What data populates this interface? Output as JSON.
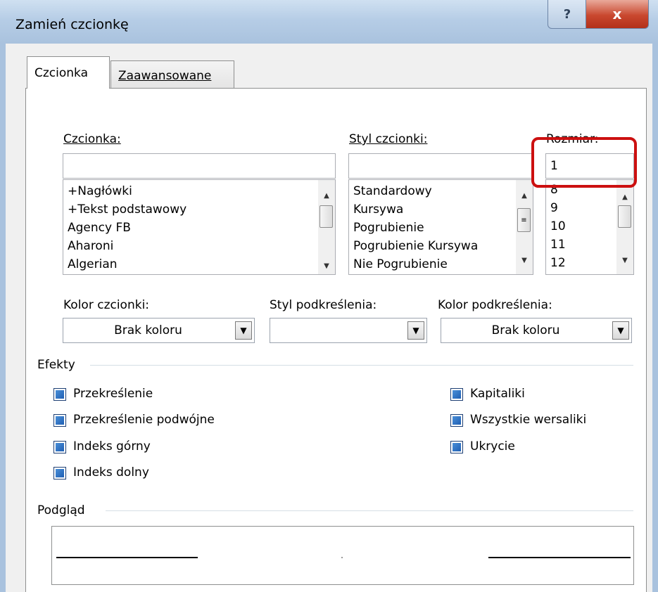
{
  "window": {
    "title": "Zamień czcionkę",
    "help_label": "?",
    "close_label": "x"
  },
  "tabs": [
    {
      "label": "Czcionka",
      "active": true
    },
    {
      "label": "Zaawansowane",
      "active": false
    }
  ],
  "font": {
    "label": "Czcionka:",
    "value": "",
    "items": [
      "+Nagłówki",
      "+Tekst podstawowy",
      "Agency FB",
      "Aharoni",
      "Algerian"
    ]
  },
  "style": {
    "label": "Styl czcionki:",
    "value": "",
    "items": [
      "Standardowy",
      "Kursywa",
      "Pogrubienie",
      "Pogrubienie Kursywa",
      "Nie Pogrubienie"
    ]
  },
  "size": {
    "label": "Rozmiar:",
    "value": "1",
    "items": [
      "8",
      "9",
      "10",
      "11",
      "12"
    ]
  },
  "font_color": {
    "label": "Kolor czcionki:",
    "value": "Brak koloru"
  },
  "underline_style": {
    "label": "Styl podkreślenia:",
    "value": ""
  },
  "underline_color": {
    "label": "Kolor podkreślenia:",
    "value": "Brak koloru"
  },
  "effects": {
    "label": "Efekty",
    "left": [
      "Przekreślenie",
      "Przekreślenie podwójne",
      "Indeks górny",
      "Indeks dolny"
    ],
    "right": [
      "Kapitaliki",
      "Wszystkie wersaliki",
      "Ukrycie"
    ]
  },
  "preview": {
    "label": "Podgląd"
  },
  "colors": {
    "highlight": "#cc1010",
    "checkbox": "#1f5fb3",
    "title_bar": "#b6cde6"
  }
}
